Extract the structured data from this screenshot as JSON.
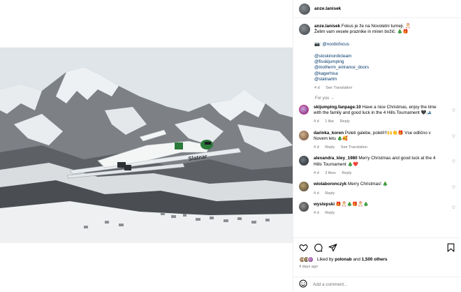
{
  "post": {
    "author": "anze.lanisek",
    "caption": {
      "text_line1": "Fokus je že na Novoletni turneji. 🎅",
      "text_line2": "Želim vam vesele praznike in miren božič. 🎄🎁",
      "photo_credit": "📷: @nordicfocus",
      "tags": [
        "@sloskinordicteam",
        "@fisskijumping",
        "@inotherm_entrance_doors",
        "@kagerhisa",
        "@slatnartm"
      ],
      "age": "4 d",
      "see_translation": "See Translation"
    },
    "photo": {
      "description": "Ski jumper in flight over snowy Alpine mountains and village",
      "ski_brand": "Slatnar",
      "colors": {
        "sky": "#e8edf0",
        "mountain": "#6b6e72",
        "snow": "#f2f4f5",
        "suit": "#f4f6f6",
        "helmet": "#2a7a3a"
      }
    }
  },
  "for_you": "For you",
  "comments": [
    {
      "user": "skijumping.fanpage.10",
      "text": "Have a nice Christmas, enjoy the time with the family and good luck in the 4 Hills Tournament 🖤🎿",
      "age": "4 d",
      "likes": "1 like",
      "reply": "Reply"
    },
    {
      "user": "darinka_koren",
      "text": "Poleti galebe, poleti!!!🙌👏🎁 Vse odlično v Novem letu 🎄🥰",
      "age": "4 d",
      "likes": "",
      "reply": "Reply",
      "see_translation": "See Translation"
    },
    {
      "user": "alexandra_kley_1980",
      "text": "Merry Christmas and good luck at the 4 Hills Tournament 🎄❤️",
      "age": "4 d",
      "likes": "3 likes",
      "reply": "Reply"
    },
    {
      "user": "wiolaboronczyk",
      "text": "Merry Christmas! 🎄",
      "age": "4 d",
      "likes": "",
      "reply": "Reply"
    },
    {
      "user": "wystepski",
      "text": "🎁🎅🎄🎁🎅🎄",
      "age": "4 d",
      "likes": "",
      "reply": "Reply"
    }
  ],
  "actions": {
    "liked_by_prefix": "Liked by",
    "liked_by_user": "polonab",
    "liked_by_and": "and",
    "liked_by_others": "1,500 others",
    "date": "4 days ago"
  },
  "add_comment": {
    "placeholder": "Add a comment..."
  }
}
